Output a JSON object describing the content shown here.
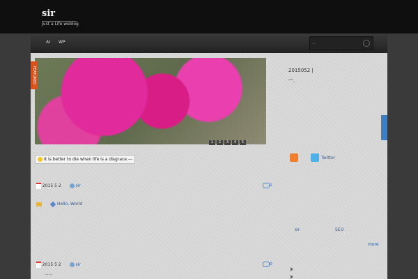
{
  "header": {
    "site_title": "sir",
    "tagline": "Just a Life weblog"
  },
  "nav": {
    "items": [
      "",
      "AI",
      "WP"
    ]
  },
  "search": {
    "placeholder": "..."
  },
  "featured": {
    "badge": "FEATURED",
    "slides": [
      "1",
      "2",
      "3",
      "4",
      "5"
    ],
    "date_line": "2015052 | ",
    "excerpt": "“”..."
  },
  "side_tab": {
    "label": ""
  },
  "quote": {
    "text": "It is better to die when life is a disgrace.---"
  },
  "social": {
    "twitter_label": "Twitter"
  },
  "posts": [
    {
      "title": "",
      "date": "2015 5 2",
      "author": "sir",
      "comments": "1",
      "excerpt": "",
      "tags": "Hello, World"
    },
    {
      "title": "",
      "date": "2015 5 2",
      "author": "sir",
      "comments": "0",
      "excerpt": "......"
    }
  ],
  "sidebar": {
    "link_sir": "sir",
    "link_seo": "SEO",
    "more": "more"
  }
}
